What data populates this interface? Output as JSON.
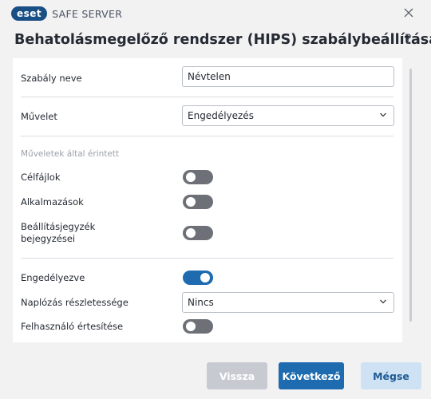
{
  "titlebar": {
    "brand": "eset",
    "product": "SAFE SERVER",
    "close_icon": "close-icon"
  },
  "header": {
    "title": "Behatolásmegelőző rendszer (HIPS) szabálybeállításai",
    "help": "?"
  },
  "form": {
    "rule_name": {
      "label": "Szabály neve",
      "value": "Névtelen"
    },
    "action": {
      "label": "Művelet",
      "value": "Engedélyezés",
      "icon": "chevron-down-icon"
    },
    "affected_section": "Műveletek által érintett",
    "target_files": {
      "label": "Célfájlok",
      "enabled": false
    },
    "applications": {
      "label": "Alkalmazások",
      "enabled": false
    },
    "registry": {
      "label_line1": "Beállításjegyzék",
      "label_line2": "bejegyzései",
      "enabled": false
    },
    "enabled": {
      "label": "Engedélyezve",
      "enabled": true
    },
    "log_level": {
      "label": "Naplózás részletessége",
      "value": "Nincs",
      "icon": "chevron-down-icon"
    },
    "notify_user": {
      "label": "Felhasználó értesítése",
      "enabled": false
    }
  },
  "buttons": {
    "back": "Vissza",
    "next": "Következő",
    "cancel": "Mégse"
  },
  "colors": {
    "brand": "#1a4f86",
    "accent": "#1e6bb0",
    "toggle_off": "#6d7077",
    "background": "#f2f2f3"
  }
}
